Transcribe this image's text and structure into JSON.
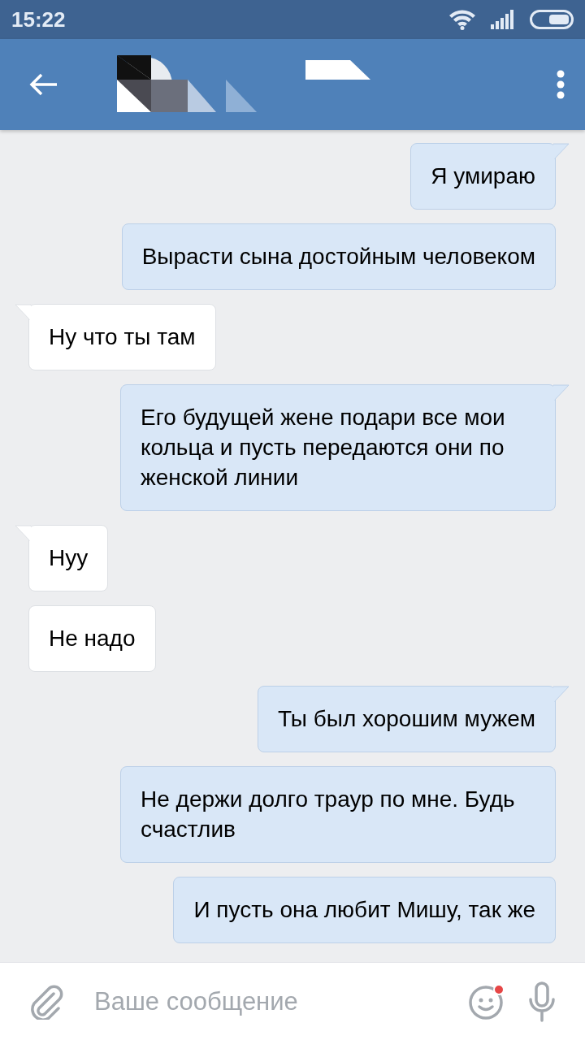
{
  "status_bar": {
    "time": "15:22"
  },
  "messages": [
    {
      "text": "Я умираю",
      "outgoing": true,
      "tail": true
    },
    {
      "text": "Вырасти сына достойным человеком",
      "outgoing": true,
      "tail": false
    },
    {
      "text": "Ну что ты там",
      "outgoing": false,
      "tail": true
    },
    {
      "text": "Его будущей жене подари все мои кольца и пусть передаются они по женской линии",
      "outgoing": true,
      "tail": true
    },
    {
      "text": "Нуу",
      "outgoing": false,
      "tail": true
    },
    {
      "text": "Не надо",
      "outgoing": false,
      "tail": false
    },
    {
      "text": "Ты был хорошим мужем",
      "outgoing": true,
      "tail": true
    },
    {
      "text": "Не держи долго траур по мне. Будь счастлив",
      "outgoing": true,
      "tail": false
    },
    {
      "text": "И пусть она любит Мишу, так же",
      "outgoing": true,
      "tail": false
    }
  ],
  "composer": {
    "placeholder": "Ваше сообщение",
    "emoji_badge": true
  }
}
